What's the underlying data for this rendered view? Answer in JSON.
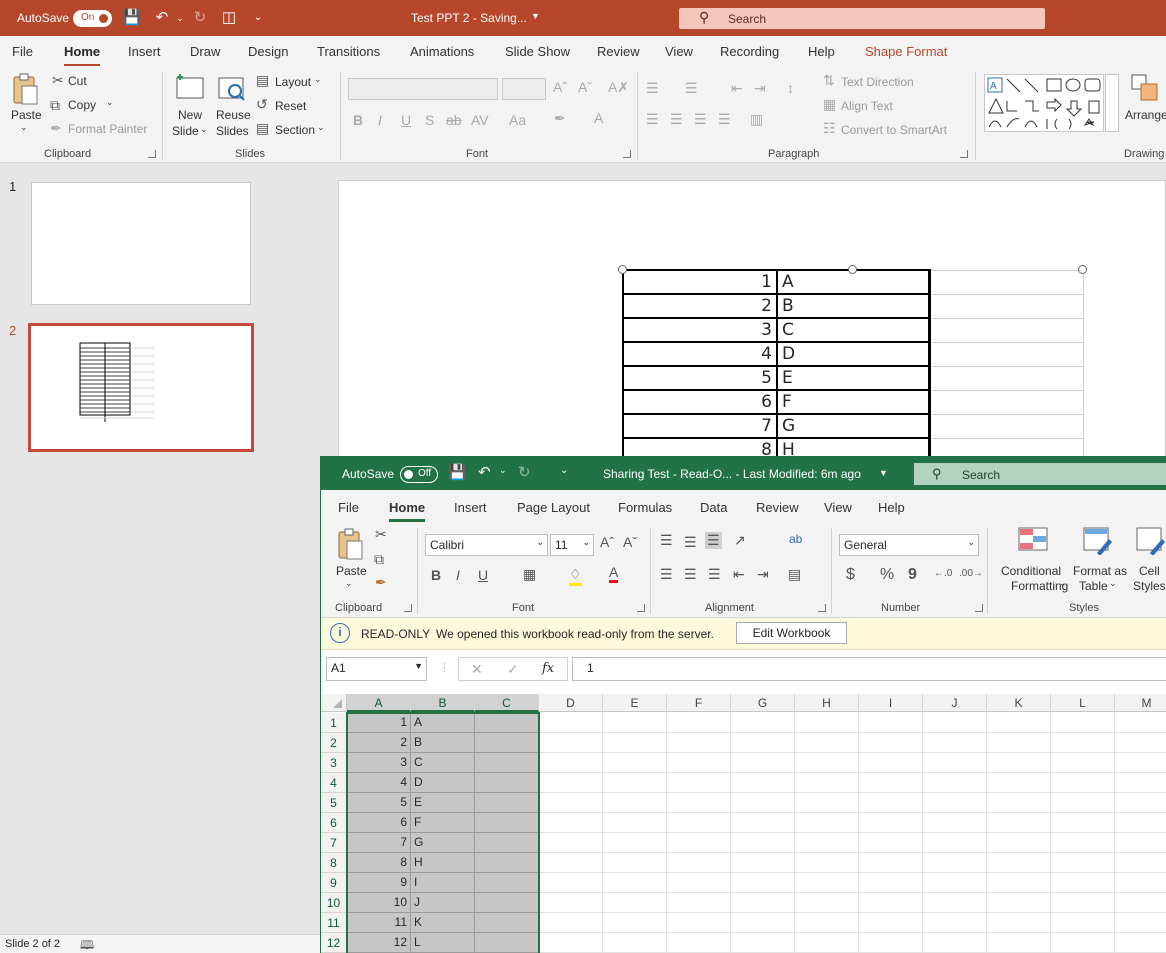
{
  "ppt": {
    "titlebar": {
      "autosave_label": "AutoSave",
      "autosave_state": "On",
      "doc_title": "Test PPT 2  -  Saving...",
      "search_placeholder": "Search"
    },
    "tabs": [
      "File",
      "Home",
      "Insert",
      "Draw",
      "Design",
      "Transitions",
      "Animations",
      "Slide Show",
      "Review",
      "View",
      "Recording",
      "Help",
      "Shape Format"
    ],
    "active_tab": "Home",
    "ribbon": {
      "clipboard": {
        "paste": "Paste",
        "cut": "Cut",
        "copy": "Copy",
        "format_painter": "Format Painter",
        "group": "Clipboard"
      },
      "slides": {
        "new_slide_1": "New",
        "new_slide_2": "Slide",
        "reuse_1": "Reuse",
        "reuse_2": "Slides",
        "layout": "Layout",
        "reset": "Reset",
        "section": "Section",
        "group": "Slides"
      },
      "font": {
        "group": "Font",
        "bold": "B",
        "italic": "I",
        "underline": "U",
        "shadow": "S",
        "strike": "ab",
        "spacing": "AV",
        "case": "Aa"
      },
      "paragraph": {
        "text_direction": "Text Direction",
        "align_text": "Align Text",
        "convert_smartart": "Convert to SmartArt",
        "group": "Paragraph"
      },
      "drawing": {
        "arrange": "Arrange",
        "group": "Drawing"
      }
    },
    "thumbnails": [
      "1",
      "2"
    ],
    "table_rows": [
      {
        "n": "1",
        "l": "A"
      },
      {
        "n": "2",
        "l": "B"
      },
      {
        "n": "3",
        "l": "C"
      },
      {
        "n": "4",
        "l": "D"
      },
      {
        "n": "5",
        "l": "E"
      },
      {
        "n": "6",
        "l": "F"
      },
      {
        "n": "7",
        "l": "G"
      },
      {
        "n": "8",
        "l": "H"
      }
    ],
    "status": "Slide 2 of 2",
    "accent": "#b7472a"
  },
  "excel": {
    "titlebar": {
      "autosave_label": "AutoSave",
      "autosave_state": "Off",
      "doc_title": "Sharing Test  -  Read-O...  -  Last Modified: 6m ago",
      "search_placeholder": "Search"
    },
    "tabs": [
      "File",
      "Home",
      "Insert",
      "Page Layout",
      "Formulas",
      "Data",
      "Review",
      "View",
      "Help"
    ],
    "active_tab": "Home",
    "ribbon": {
      "clipboard": {
        "paste": "Paste",
        "group": "Clipboard"
      },
      "font": {
        "name": "Calibri",
        "size": "11",
        "bold": "B",
        "italic": "I",
        "underline": "U",
        "group": "Font"
      },
      "alignment": {
        "group": "Alignment"
      },
      "number": {
        "format": "General",
        "currency": "$",
        "percent": "%",
        "comma": "9",
        "group": "Number"
      },
      "styles": {
        "cond_1": "Conditional",
        "cond_2": "Formatting",
        "table_1": "Format as",
        "table_2": "Table",
        "cell_1": "Cell",
        "cell_2": "Styles",
        "group": "Styles"
      }
    },
    "infobar": {
      "title": "READ-ONLY",
      "message": "We opened this workbook read-only from the server.",
      "button": "Edit Workbook"
    },
    "formula_bar": {
      "name_box": "A1",
      "fx": "fx",
      "value": "1"
    },
    "columns": [
      "A",
      "B",
      "C",
      "D",
      "E",
      "F",
      "G",
      "H",
      "I",
      "J",
      "K",
      "L",
      "M"
    ],
    "rows": [
      {
        "r": "1",
        "a": "1",
        "b": "A"
      },
      {
        "r": "2",
        "a": "2",
        "b": "B"
      },
      {
        "r": "3",
        "a": "3",
        "b": "C"
      },
      {
        "r": "4",
        "a": "4",
        "b": "D"
      },
      {
        "r": "5",
        "a": "5",
        "b": "E"
      },
      {
        "r": "6",
        "a": "6",
        "b": "F"
      },
      {
        "r": "7",
        "a": "7",
        "b": "G"
      },
      {
        "r": "8",
        "a": "8",
        "b": "H"
      },
      {
        "r": "9",
        "a": "9",
        "b": "I"
      },
      {
        "r": "10",
        "a": "10",
        "b": "J"
      },
      {
        "r": "11",
        "a": "11",
        "b": "K"
      },
      {
        "r": "12",
        "a": "12",
        "b": "L"
      }
    ],
    "accent": "#217346"
  }
}
